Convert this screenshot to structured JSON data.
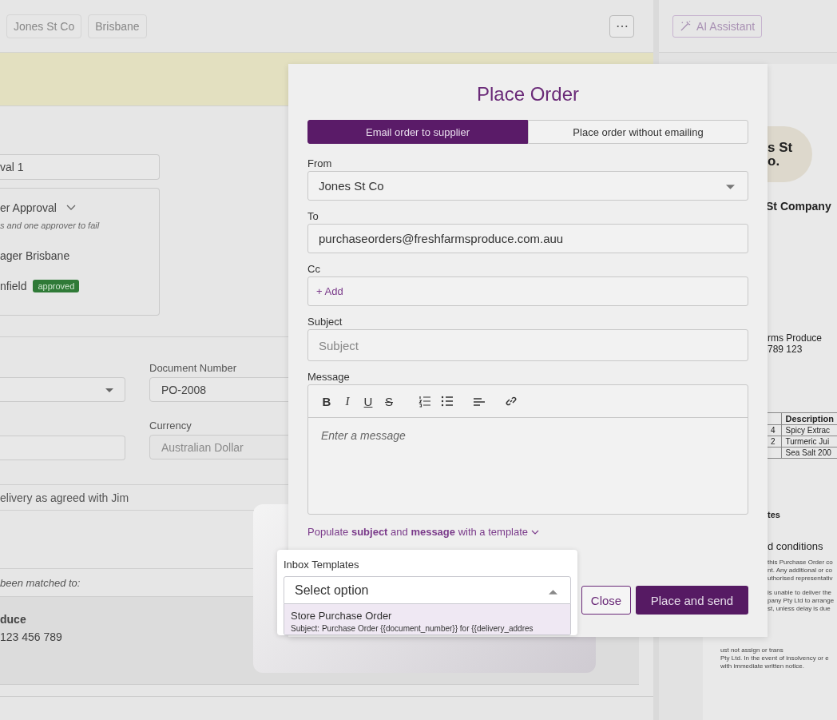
{
  "header": {
    "tags": [
      "Jones St Co",
      "Brisbane"
    ],
    "more": "⋯"
  },
  "approval": {
    "field_value": "val 1",
    "title": "er Approval",
    "note": "s and one approver to fail",
    "approvers": [
      {
        "name": "ager Brisbane"
      },
      {
        "name": "nfield",
        "badge": "approved"
      }
    ]
  },
  "details": {
    "document_number": {
      "label": "Document Number",
      "value": "PO-2008"
    },
    "currency": {
      "label": "Currency",
      "value": "Australian Dollar",
      "disabled": true
    }
  },
  "notes_value": "elivery as agreed with Jim",
  "match": {
    "heading": "been matched to:",
    "name": "duce",
    "phone": "123 456 789"
  },
  "assistant": {
    "label": "AI Assistant"
  },
  "pdf": {
    "logo_lines": [
      "s St",
      "o."
    ],
    "company": "St Company",
    "supplier_lines": [
      "rms Produce",
      "789 123"
    ],
    "table": {
      "columns": [
        "",
        "Description"
      ],
      "rows": [
        [
          "4",
          "Spicy Extrac"
        ],
        [
          "2",
          "Turmeric Jui"
        ],
        [
          "",
          "Sea Salt 200"
        ]
      ]
    },
    "notes_heading": "tes",
    "terms_heading": "d conditions",
    "terms": [
      [
        "this Purchase Order co",
        "nt. Any additional or co",
        "uthorised representativ"
      ],
      [
        "is unable to deliver the",
        "pany Pty Ltd to arrange",
        "st, unless delay is due"
      ]
    ],
    "terms_below": [
      "ust not assign or trans",
      "Pty Ltd. In the event of insolvency or e",
      "with immediate written notice."
    ]
  },
  "modal": {
    "title": "Place Order",
    "tabs": [
      {
        "label": "Email order to supplier",
        "selected": true
      },
      {
        "label": "Place order without emailing",
        "selected": false
      }
    ],
    "from": {
      "label": "From",
      "value": "Jones St Co"
    },
    "to": {
      "label": "To",
      "value": "purchaseorders@freshfarmsproduce.com.auu"
    },
    "cc": {
      "label": "Cc",
      "add": "+ Add"
    },
    "subject": {
      "label": "Subject",
      "placeholder": "Subject"
    },
    "message": {
      "label": "Message",
      "placeholder": "Enter a message",
      "toolbar": [
        {
          "kind": "bold",
          "glyph": "B"
        },
        {
          "kind": "italic",
          "glyph": "I"
        },
        {
          "kind": "underline",
          "glyph": "U"
        },
        {
          "kind": "strike",
          "glyph": "S"
        },
        {
          "kind": "ordered-list"
        },
        {
          "kind": "bullet-list"
        },
        {
          "kind": "align"
        },
        {
          "kind": "link"
        }
      ]
    },
    "template_link": "Populate **subject** and **message** with a template",
    "close": "Close",
    "submit": "Place and send"
  },
  "templates": {
    "label": "Inbox Templates",
    "placeholder": "Select option",
    "expanded": true,
    "options": [
      {
        "title": "Store Purchase Order",
        "subtitle": "Subject: Purchase Order {{document_number}} for {{delivery_addres",
        "highlighted": true
      }
    ]
  }
}
